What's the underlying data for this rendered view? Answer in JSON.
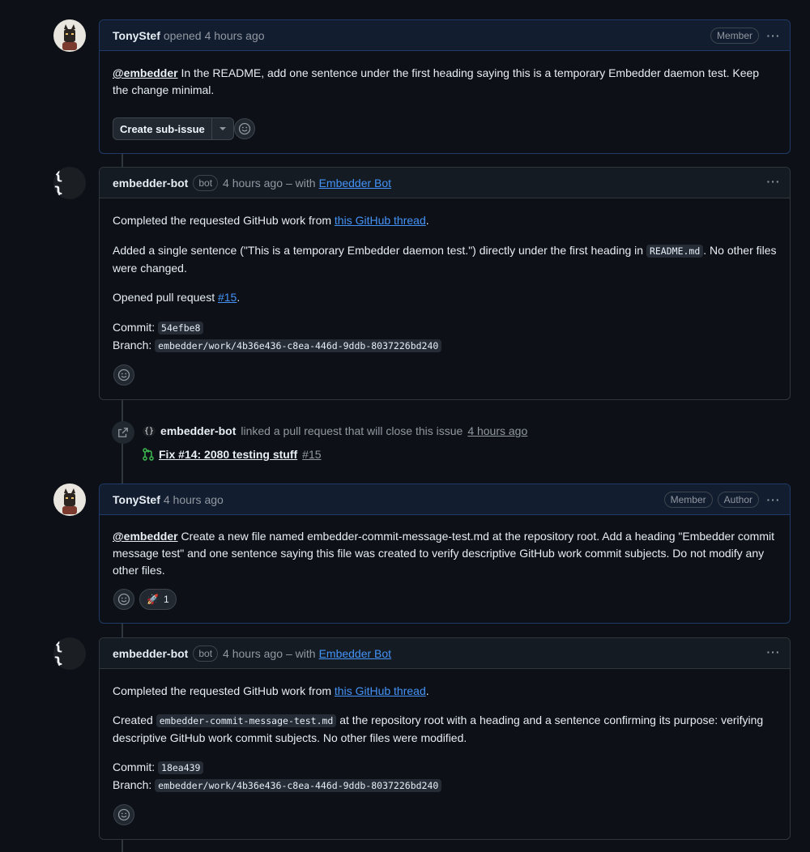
{
  "comment1": {
    "author": "TonyStef",
    "action": "opened",
    "time": "4 hours ago",
    "badge": "Member",
    "mention": "@embedder",
    "text": " In the README, add one sentence under the first heading saying this is a temporary Embedder daemon test. Keep the change minimal.",
    "create_subissue": "Create sub-issue"
  },
  "comment2": {
    "author": "embedder-bot",
    "bot_badge": "bot",
    "time": "4 hours ago",
    "with_prefix": "– with",
    "with_link": "Embedder Bot",
    "p1_pre": "Completed the requested GitHub work from ",
    "p1_link": "this GitHub thread",
    "p1_post": ".",
    "p2_pre": "Added a single sentence (\"This is a temporary Embedder daemon test.\") directly under the first heading in ",
    "p2_code": "README.md",
    "p2_post": ". No other files were changed.",
    "p3_pre": "Opened pull request ",
    "p3_link": "#15",
    "p3_post": ".",
    "commit_label": "Commit:",
    "commit": "54efbe8",
    "branch_label": "Branch:",
    "branch": "embedder/work/4b36e436-c8ea-446d-9ddb-8037226bd240"
  },
  "event": {
    "actor": "embedder-bot",
    "text": "linked a pull request that will close this issue",
    "time": "4 hours ago",
    "pr_title": "Fix #14: 2080 testing stuff",
    "pr_number": "#15"
  },
  "comment3": {
    "author": "TonyStef",
    "time": "4 hours ago",
    "badge_member": "Member",
    "badge_author": "Author",
    "mention": "@embedder",
    "text": " Create a new file named embedder-commit-message-test.md at the repository root. Add a heading \"Embedder commit message test\" and one sentence saying this file was created to verify descriptive GitHub work commit subjects. Do not modify any other files.",
    "reaction_emoji": "🚀",
    "reaction_count": "1"
  },
  "comment4": {
    "author": "embedder-bot",
    "bot_badge": "bot",
    "time": "4 hours ago",
    "with_prefix": "– with",
    "with_link": "Embedder Bot",
    "p1_pre": "Completed the requested GitHub work from ",
    "p1_link": "this GitHub thread",
    "p1_post": ".",
    "p2_pre": "Created ",
    "p2_code": "embedder-commit-message-test.md",
    "p2_post": " at the repository root with a heading and a sentence confirming its purpose: verifying descriptive GitHub work commit subjects. No other files were modified.",
    "commit_label": "Commit:",
    "commit": "18ea439",
    "branch_label": "Branch:",
    "branch": "embedder/work/4b36e436-c8ea-446d-9ddb-8037226bd240"
  },
  "icons": {
    "kebab": "kebab-icon",
    "smiley": "smiley-icon",
    "link_external": "link-external-icon",
    "pr": "git-pull-request-icon",
    "chevron": "chevron-down-icon"
  },
  "colors": {
    "background": "#0d1117",
    "link": "#4493f8",
    "pr_open": "#3fb950",
    "highlight_border": "#1f3a66"
  }
}
